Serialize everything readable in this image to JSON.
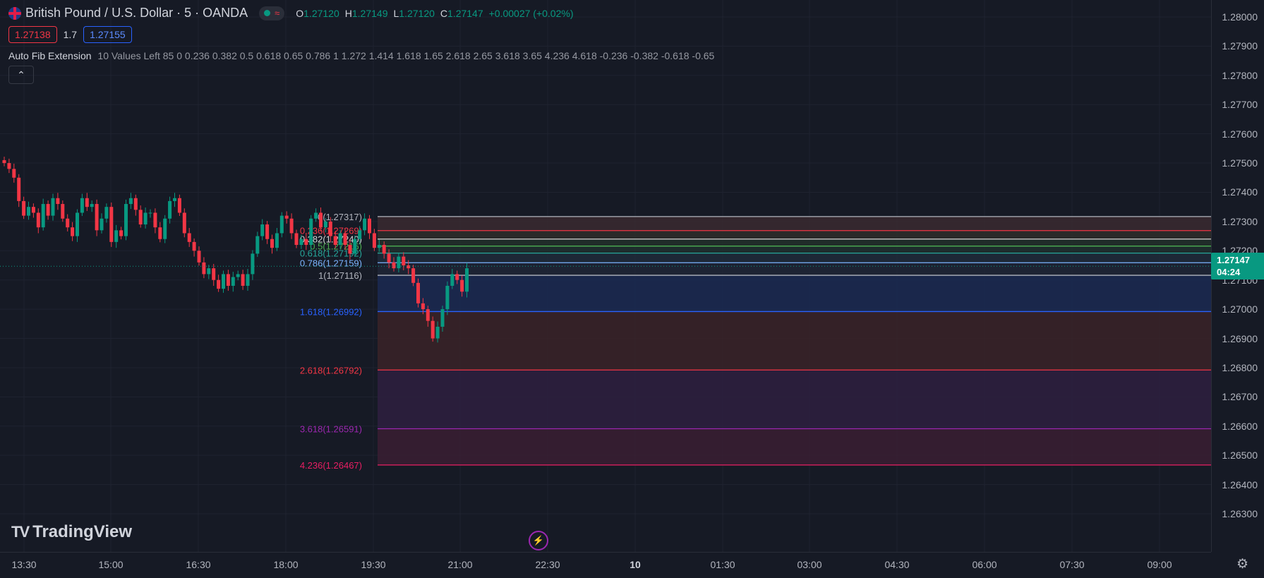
{
  "header": {
    "symbol_title": "British Pound / U.S. Dollar · 5 · OANDA",
    "ohlc": [
      {
        "k": "O",
        "v": "1.27120"
      },
      {
        "k": "H",
        "v": "1.27149"
      },
      {
        "k": "L",
        "v": "1.27120"
      },
      {
        "k": "C",
        "v": "1.27147"
      }
    ],
    "change": "+0.00027 (+0.02%)",
    "sell_price": "1.27138",
    "spread": "1.7",
    "buy_price": "1.27155"
  },
  "indicator": {
    "name": "Auto Fib Extension",
    "params": "10 Values Left 85 0 0.236 0.382 0.5 0.618 0.65 0.786 1 1.272 1.414 1.618 1.65 2.618 2.65 3.618 3.65 4.236 4.618 -0.236 -0.382 -0.618 -0.65",
    "collapse_icon": "chevron-up-icon"
  },
  "price_axis": {
    "ticks": [
      "1.28000",
      "1.27900",
      "1.27800",
      "1.27700",
      "1.27600",
      "1.27500",
      "1.27400",
      "1.27300",
      "1.27200",
      "1.27100",
      "1.27000",
      "1.26900",
      "1.26800",
      "1.26700",
      "1.26600",
      "1.26500",
      "1.26400",
      "1.26300"
    ],
    "last_price": "1.27147",
    "countdown": "04:24"
  },
  "time_axis": {
    "ticks": [
      "13:30",
      "15:00",
      "16:30",
      "18:00",
      "19:30",
      "21:00",
      "22:30",
      "10",
      "01:30",
      "03:00",
      "04:30",
      "06:00",
      "07:30",
      "09:00"
    ]
  },
  "fib_labels": [
    {
      "text": "0(1.27317)",
      "color": "#b2b5be",
      "price": 1.27317
    },
    {
      "text": "0.236(1.27269)",
      "color": "#f23645",
      "price": 1.27269
    },
    {
      "text": "0.382(1.27240)",
      "color": "#d4d4d4",
      "price": 1.2724
    },
    {
      "text": "0.5(1.27216)",
      "color": "#4caf50",
      "price": 1.27216
    },
    {
      "text": "0.618(1.27192)",
      "color": "#26a69a",
      "price": 1.27192
    },
    {
      "text": "0.786(1.27159)",
      "color": "#7cb5ff",
      "price": 1.27159
    },
    {
      "text": "1(1.27116)",
      "color": "#b2b5be",
      "price": 1.27116
    },
    {
      "text": "1.618(1.26992)",
      "color": "#2962ff",
      "price": 1.26992
    },
    {
      "text": "2.618(1.26792)",
      "color": "#f23645",
      "price": 1.26792
    },
    {
      "text": "3.618(1.26591)",
      "color": "#9c27b0",
      "price": 1.26591
    },
    {
      "text": "4.236(1.26467)",
      "color": "#e91e63",
      "price": 1.26467
    }
  ],
  "branding": {
    "logo_text": "TradingView"
  },
  "colors": {
    "up": "#089981",
    "down": "#f23645",
    "background": "#161a25"
  },
  "chart_data": {
    "type": "candlestick",
    "symbol": "GBPUSD",
    "timeframe": "5",
    "y_range": [
      1.2625,
      1.2805
    ],
    "x_ticks": [
      "13:30",
      "15:00",
      "16:30",
      "18:00",
      "19:30",
      "21:00",
      "22:30",
      "10",
      "01:30",
      "03:00",
      "04:30",
      "06:00",
      "07:30",
      "09:00"
    ],
    "candles_close": [
      1.275,
      1.2748,
      1.2745,
      1.2737,
      1.2732,
      1.2735,
      1.2733,
      1.2728,
      1.2736,
      1.2732,
      1.2738,
      1.2736,
      1.2731,
      1.2728,
      1.2725,
      1.2733,
      1.2738,
      1.2735,
      1.2736,
      1.2727,
      1.2731,
      1.2735,
      1.2723,
      1.2727,
      1.2725,
      1.2736,
      1.2738,
      1.2734,
      1.2729,
      1.2733,
      1.2733,
      1.2728,
      1.2724,
      1.2731,
      1.2737,
      1.2738,
      1.2733,
      1.2726,
      1.2723,
      1.272,
      1.2716,
      1.2712,
      1.2714,
      1.271,
      1.2707,
      1.2712,
      1.2708,
      1.2711,
      1.2712,
      1.2708,
      1.2712,
      1.2719,
      1.2725,
      1.2729,
      1.2724,
      1.2721,
      1.2726,
      1.2732,
      1.2731,
      1.2726,
      1.2722,
      1.2724,
      1.2722,
      1.2731,
      1.2733,
      1.2728,
      1.273,
      1.2725,
      1.2722,
      1.2726,
      1.2722,
      1.2719,
      1.2724,
      1.2727,
      1.2731,
      1.2726,
      1.2721,
      1.2722,
      1.2719,
      1.2716,
      1.2714,
      1.2718,
      1.2715,
      1.2714,
      1.2709,
      1.2702,
      1.27,
      1.2696,
      1.269,
      1.2694,
      1.27,
      1.2708,
      1.2712,
      1.271,
      1.2706,
      1.2714
    ],
    "fib_levels": [
      {
        "ratio": 0,
        "price": 1.27317
      },
      {
        "ratio": 0.236,
        "price": 1.27269
      },
      {
        "ratio": 0.382,
        "price": 1.2724
      },
      {
        "ratio": 0.5,
        "price": 1.27216
      },
      {
        "ratio": 0.618,
        "price": 1.27192
      },
      {
        "ratio": 0.786,
        "price": 1.27159
      },
      {
        "ratio": 1,
        "price": 1.27116
      },
      {
        "ratio": 1.618,
        "price": 1.26992
      },
      {
        "ratio": 2.618,
        "price": 1.26792
      },
      {
        "ratio": 3.618,
        "price": 1.26591
      },
      {
        "ratio": 4.236,
        "price": 1.26467
      }
    ]
  }
}
